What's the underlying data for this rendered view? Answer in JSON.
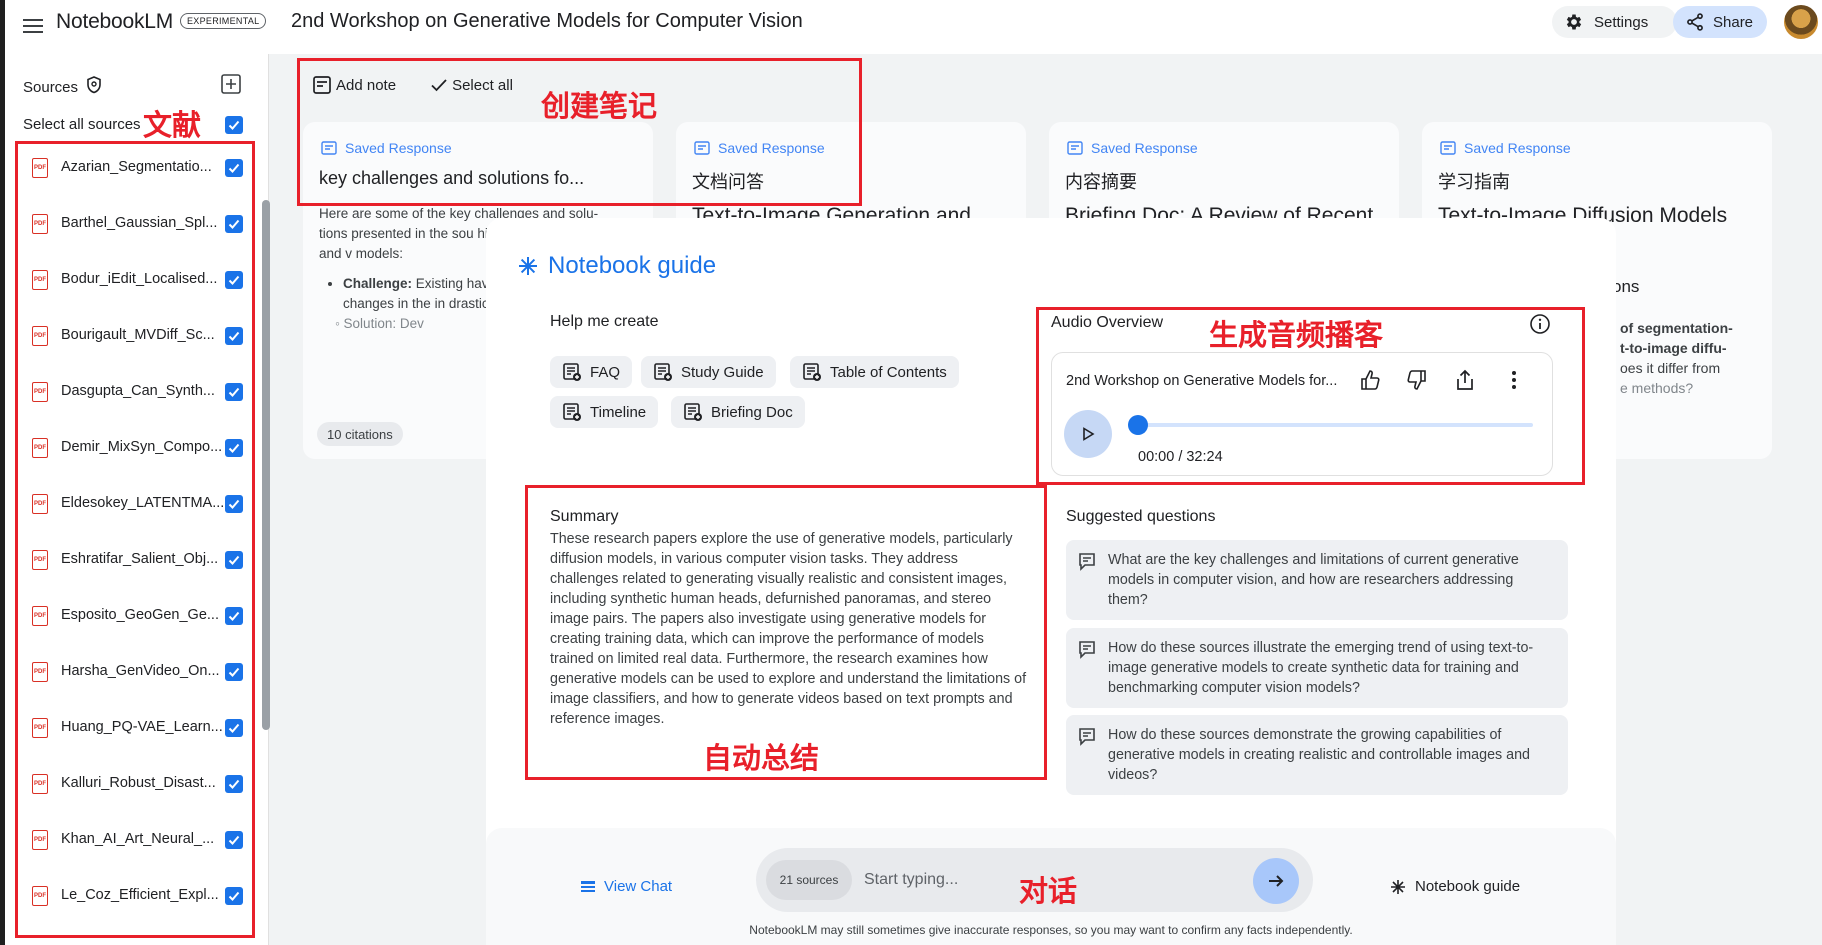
{
  "app": {
    "brand": "NotebookLM",
    "badge": "EXPERIMENTAL",
    "page_title": "2nd Workshop on Generative Models for Computer Vision",
    "settings_label": "Settings",
    "share_label": "Share"
  },
  "sidebar": {
    "sources_label": "Sources",
    "select_all_label": "Select all sources",
    "items": [
      {
        "name": "Azarian_Segmentatio...",
        "icon": "pdf-icon",
        "checked": true
      },
      {
        "name": "Barthel_Gaussian_Spl...",
        "icon": "pdf-icon",
        "checked": true
      },
      {
        "name": "Bodur_iEdit_Localised...",
        "icon": "pdf-icon",
        "checked": true
      },
      {
        "name": "Bourigault_MVDiff_Sc...",
        "icon": "pdf-icon",
        "checked": true
      },
      {
        "name": "Dasgupta_Can_Synth...",
        "icon": "pdf-icon",
        "checked": true
      },
      {
        "name": "Demir_MixSyn_Compo...",
        "icon": "pdf-icon",
        "checked": true
      },
      {
        "name": "Eldesokey_LATENTMA...",
        "icon": "pdf-icon",
        "checked": true
      },
      {
        "name": "Eshratifar_Salient_Obj...",
        "icon": "pdf-icon",
        "checked": true
      },
      {
        "name": "Esposito_GeoGen_Ge...",
        "icon": "pdf-icon",
        "checked": true
      },
      {
        "name": "Harsha_GenVideo_On...",
        "icon": "pdf-icon",
        "checked": true
      },
      {
        "name": "Huang_PQ-VAE_Learn...",
        "icon": "pdf-icon",
        "checked": true
      },
      {
        "name": "Kalluri_Robust_Disast...",
        "icon": "pdf-icon",
        "checked": true
      },
      {
        "name": "Khan_AI_Art_Neural_...",
        "icon": "pdf-icon",
        "checked": true
      },
      {
        "name": "Le_Coz_Efficient_Expl...",
        "icon": "pdf-icon",
        "checked": true
      }
    ],
    "pdf_badge": "PDF"
  },
  "notes_toolbar": {
    "add_note": "Add note",
    "select_all": "Select all"
  },
  "notes": [
    {
      "tag": "Saved Response",
      "title": "key challenges and solutions fo...",
      "body_intro": "Here are some of the key challenges and solu- tions presented in the sou high-quality images and v models:",
      "bullet_label": "Challenge:",
      "bullet_text": " Existing have limited control small changes in the in drastically differe",
      "sub_text": "Solution: Dev",
      "citations": "10 citations"
    },
    {
      "tag": "Saved Response",
      "title": "文档问答",
      "body": "Text-to-Image Generation and"
    },
    {
      "tag": "Saved Response",
      "title": "内容摘要",
      "body": "Briefing Doc: A Review of Recent"
    },
    {
      "tag": "Saved Response",
      "title": "学习指南",
      "body": "Text-to-Image Diffusion Models",
      "frag1": "ons",
      "frag2": "of segmentation-",
      "frag3": "t-to-image diffu-",
      "frag4": "oes it differ from",
      "frag5": "e methods?"
    }
  ],
  "guide": {
    "title": "Notebook guide",
    "help_label": "Help me create",
    "chips": [
      "FAQ",
      "Study Guide",
      "Table of Contents",
      "Timeline",
      "Briefing Doc"
    ],
    "audio": {
      "label": "Audio Overview",
      "title": "2nd Workshop on Generative Models for...",
      "time": "00:00 / 32:24",
      "progress": 0.0
    },
    "summary": {
      "label": "Summary",
      "text": "These research papers explore the use of generative models, particularly diffusion models, in various computer vision tasks. They address challenges related to generating visually realistic and consistent images, including synthetic human heads, defurnished panoramas, and stereo image pairs. The papers also investigate using generative models for creating training data, which can improve the performance of models trained on limited real data. Furthermore, the research examines how generative models can be used to explore and understand the limitations of image classifiers, and how to generate videos based on text prompts and reference images."
    },
    "suggested_label": "Suggested questions",
    "suggested": [
      "What are the key challenges and limitations of current generative models in computer vision, and how are researchers addressing them?",
      "How do these sources illustrate the emerging trend of using text-to-image generative models to create synthetic data for training and benchmarking computer vision models?",
      "How do these sources demonstrate the growing capabilities of generative models in creating realistic and controllable images and videos?"
    ]
  },
  "chat": {
    "view_chat": "View Chat",
    "sources_count": "21 sources",
    "placeholder": "Start typing...",
    "notebook_guide": "Notebook guide",
    "disclaimer": "NotebookLM may still sometimes give inaccurate responses, so you may want to confirm any facts independently."
  },
  "annotations": {
    "sources": "文献",
    "notes": "创建笔记",
    "audio": "生成音频播客",
    "summary": "自动总结",
    "chat": "对话"
  },
  "colors": {
    "accent": "#1a73e8",
    "annotation_red": "#e8202a",
    "pdf_red": "#d93025",
    "share_bg": "#d3e3fd"
  }
}
